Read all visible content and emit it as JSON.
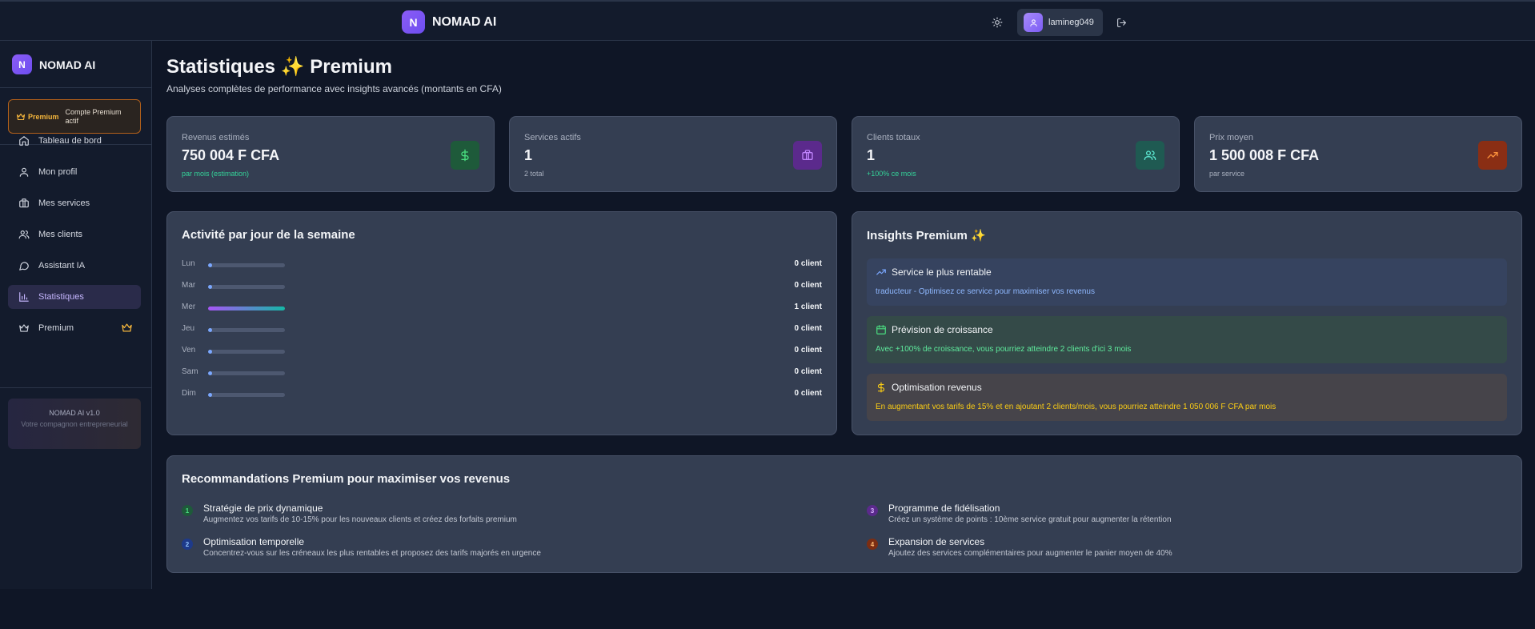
{
  "app": {
    "name": "NOMAD AI",
    "logo_letter": "N"
  },
  "header": {
    "username": "lamineg049"
  },
  "sidebar": {
    "brand": "NOMAD AI",
    "premium_badge": {
      "label": "Premium",
      "text": "Compte Premium actif"
    },
    "items": [
      {
        "label": "Tableau de bord",
        "icon": "home-icon",
        "active": false
      },
      {
        "label": "Mon profil",
        "icon": "user-icon",
        "active": false
      },
      {
        "label": "Mes services",
        "icon": "briefcase-icon",
        "active": false
      },
      {
        "label": "Mes clients",
        "icon": "users-icon",
        "active": false
      },
      {
        "label": "Assistant IA",
        "icon": "chat-icon",
        "active": false
      },
      {
        "label": "Statistiques",
        "icon": "bar-chart-icon",
        "active": true
      },
      {
        "label": "Premium",
        "icon": "crown-icon",
        "active": false
      }
    ],
    "version": {
      "title": "NOMAD AI v1.0",
      "tagline": "Votre compagnon entrepreneurial"
    }
  },
  "page": {
    "title": "Statistiques ✨ Premium",
    "subtitle": "Analyses complètes de performance avec insights avancés (montants en CFA)"
  },
  "stats": [
    {
      "label": "Revenus estimés",
      "value": "750 004 F CFA",
      "note": "par mois (estimation)",
      "note_color": "#34d399",
      "icon": "dollar-icon",
      "icon_bg": "#1e5a3a",
      "icon_color": "#4ade80"
    },
    {
      "label": "Services actifs",
      "value": "1",
      "note": "2 total",
      "note_color": "#a9b0bf",
      "icon": "briefcase-icon",
      "icon_bg": "#5b2a8c",
      "icon_color": "#c084fc"
    },
    {
      "label": "Clients totaux",
      "value": "1",
      "note": "+100% ce mois",
      "note_color": "#34d399",
      "icon": "users-icon",
      "icon_bg": "#1f5a52",
      "icon_color": "#5eead4"
    },
    {
      "label": "Prix moyen",
      "value": "1 500 008 F CFA",
      "note": "par service",
      "note_color": "#a9b0bf",
      "icon": "trending-up-icon",
      "icon_bg": "#8a2e14",
      "icon_color": "#fb923c"
    }
  ],
  "activity": {
    "title": "Activité par jour de la semaine",
    "days": [
      {
        "day": "Lun",
        "count": "0 client",
        "fraction": 0
      },
      {
        "day": "Mar",
        "count": "0 client",
        "fraction": 0
      },
      {
        "day": "Mer",
        "count": "1 client",
        "fraction": 1
      },
      {
        "day": "Jeu",
        "count": "0 client",
        "fraction": 0
      },
      {
        "day": "Ven",
        "count": "0 client",
        "fraction": 0
      },
      {
        "day": "Sam",
        "count": "0 client",
        "fraction": 0
      },
      {
        "day": "Dim",
        "count": "0 client",
        "fraction": 0
      }
    ]
  },
  "insights": {
    "title": "Insights Premium ✨",
    "items": [
      {
        "title": "Service le plus rentable",
        "text": "traducteur - Optimisez ce service pour maximiser vos revenus",
        "icon": "trending-up-icon",
        "bg": "#36435f",
        "text_color": "#8fb8ff",
        "icon_color": "#7aa7ff"
      },
      {
        "title": "Prévision de croissance",
        "text": "Avec +100% de croissance, vous pourriez atteindre 2 clients d'ici 3 mois",
        "icon": "calendar-icon",
        "bg": "#344a48",
        "text_color": "#5eea9c",
        "icon_color": "#4ade80"
      },
      {
        "title": "Optimisation revenus",
        "text": "En augmentant vos tarifs de 15% et en ajoutant 2 clients/mois, vous pourriez atteindre 1 050 006 F CFA par mois",
        "icon": "dollar-icon",
        "bg": "#46444a",
        "text_color": "#facc15",
        "icon_color": "#facc15"
      }
    ]
  },
  "recommendations": {
    "title": "Recommandations Premium pour maximiser vos revenus",
    "items": [
      {
        "num": "1",
        "title": "Stratégie de prix dynamique",
        "desc": "Augmentez vos tarifs de 10-15% pour les nouveaux clients et créez des forfaits premium",
        "num_bg": "#1e5a3a",
        "num_color": "#4ade80"
      },
      {
        "num": "2",
        "title": "Optimisation temporelle",
        "desc": "Concentrez-vous sur les créneaux les plus rentables et proposez des tarifs majorés en urgence",
        "num_bg": "#1e3a8a",
        "num_color": "#93c5fd"
      },
      {
        "num": "3",
        "title": "Programme de fidélisation",
        "desc": "Créez un système de points : 10ème service gratuit pour augmenter la rétention",
        "num_bg": "#5b2a8c",
        "num_color": "#d8b4fe"
      },
      {
        "num": "4",
        "title": "Expansion de services",
        "desc": "Ajoutez des services complémentaires pour augmenter le panier moyen de 40%",
        "num_bg": "#7c2d12",
        "num_color": "#fdba74"
      }
    ]
  }
}
